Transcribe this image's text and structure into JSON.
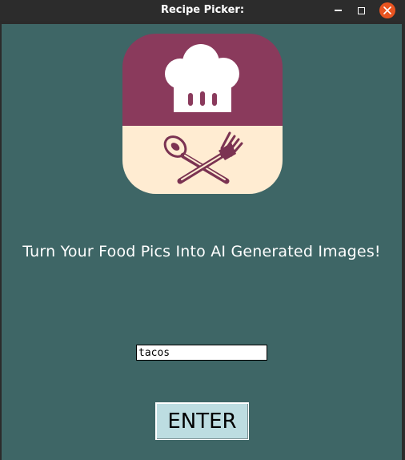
{
  "window": {
    "title": "Recipe Picker:"
  },
  "colors": {
    "titlebar": "#2c2c2c",
    "background": "#3e6666",
    "logo_top": "#8a3a5c",
    "logo_bottom": "#ffecd2",
    "close_button": "#e95420",
    "enter_button": "#bddde1"
  },
  "logo": {
    "icons": [
      "chef-hat-icon",
      "spoon-icon",
      "fork-icon"
    ]
  },
  "main": {
    "tagline": "Turn Your Food Pics Into AI Generated Images!",
    "input_value": "tacos",
    "enter_label": "ENTER"
  }
}
